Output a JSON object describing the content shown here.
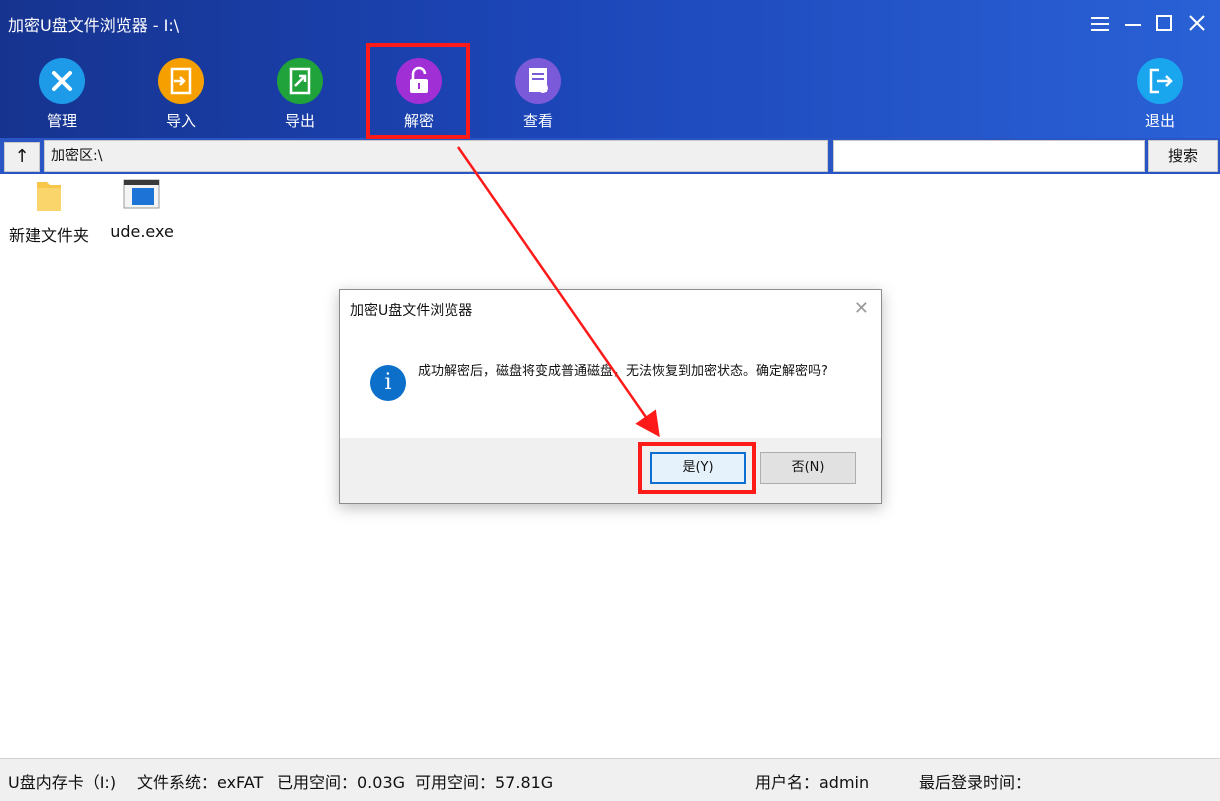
{
  "window": {
    "title": "加密U盘文件浏览器  - I:\\",
    "controls": [
      "menu-icon",
      "minimize-icon",
      "maximize-icon",
      "close-icon"
    ]
  },
  "toolbar": {
    "manage": {
      "label": "管理",
      "icon": "tools-icon",
      "color": "#1e9be8"
    },
    "import": {
      "label": "导入",
      "icon": "import-icon",
      "color": "#f5a000"
    },
    "export": {
      "label": "导出",
      "icon": "export-icon",
      "color": "#1fa33a"
    },
    "decrypt": {
      "label": "解密",
      "icon": "unlock-icon",
      "color": "#a12fd6"
    },
    "view": {
      "label": "查看",
      "icon": "document-search-icon",
      "color": "#7a5ad8"
    },
    "exit": {
      "label": "退出",
      "icon": "exit-icon",
      "color": "#1aa6ee"
    }
  },
  "addressbar": {
    "up_label": "↑",
    "path": "加密区:\\",
    "search_value": "",
    "search_button": "搜索"
  },
  "files": [
    {
      "name": "新建文件夹",
      "icon": "folder-icon"
    },
    {
      "name": "ude.exe",
      "icon": "exe-icon"
    }
  ],
  "dialog": {
    "title": "加密U盘文件浏览器",
    "message": "成功解密后，磁盘将变成普通磁盘，无法恢复到加密状态。确定解密吗?",
    "yes_label": "是(Y)",
    "no_label": "否(N)"
  },
  "statusbar": {
    "drive": "U盘内存卡（I:)",
    "filesystem": "文件系统：exFAT",
    "used": "已用空间：0.03G",
    "free": "可用空间：57.81G",
    "user": "用户名：admin",
    "last_login": "最后登录时间："
  },
  "colors": {
    "highlight": "#ff1a1a",
    "titlebar": "#1c46b8"
  }
}
